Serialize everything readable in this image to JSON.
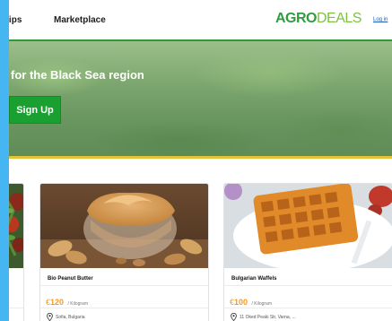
{
  "nav": {
    "items": [
      {
        "label": "Tips"
      },
      {
        "label": "Marketplace"
      }
    ],
    "logo": {
      "part1": "AGRO",
      "part2": "DEALS"
    },
    "login_label": "Log in"
  },
  "hero": {
    "title": "for the Black Sea region",
    "signup_label": "Sign Up"
  },
  "products": [
    {
      "title": "Bio Peanut Butter",
      "currency": "€",
      "price": "120",
      "unit": "/ Kilogram",
      "location": "Sofia, Bulgaria"
    },
    {
      "title": "Bulgarian Waffels",
      "currency": "€",
      "price": "100",
      "unit": "/ Kilogram",
      "location": "11 Oked Peaki Str, Varna, ..."
    }
  ],
  "colors": {
    "brand_green": "#2f9d3f",
    "brand_light_green": "#7ec142",
    "signup_green": "#19a030",
    "price_orange": "#f39a1f",
    "hero_accent_yellow": "#e2c43a",
    "edge_blue": "#45b6f2",
    "link_blue": "#1a5bb8"
  },
  "icons": [
    "location-pin-icon"
  ]
}
